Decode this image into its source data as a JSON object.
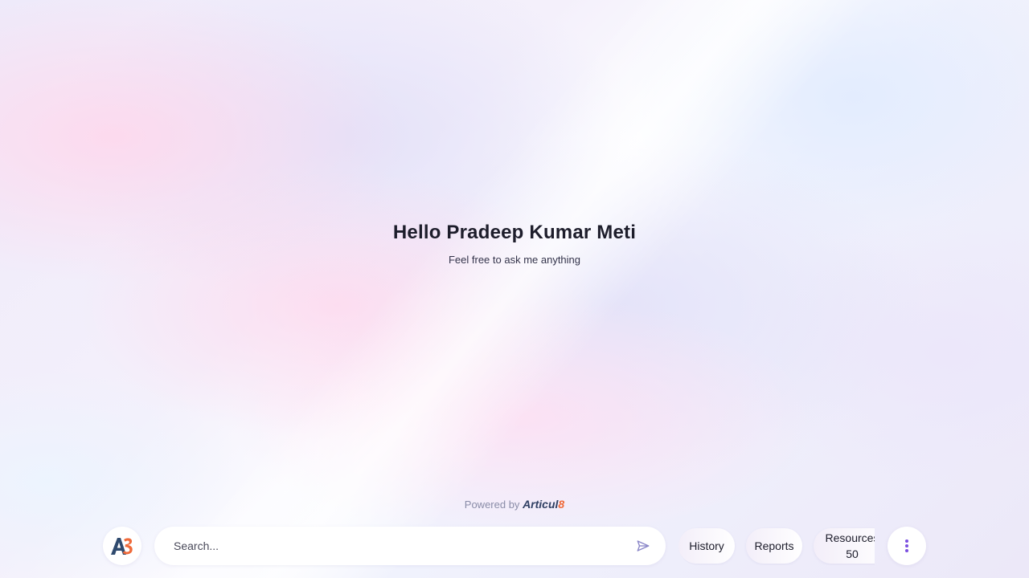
{
  "greeting": {
    "title": "Hello Pradeep Kumar Meti",
    "subtitle": "Feel free to ask me anything"
  },
  "footer": {
    "powered_by": "Powered by",
    "brand_text": "Articul",
    "brand_suffix": "8"
  },
  "search": {
    "placeholder": "Search...",
    "value": ""
  },
  "actions": {
    "history_label": "History",
    "reports_label": "Reports",
    "resources_label": "Resources",
    "resources_count": "50"
  },
  "icons": {
    "logo": "a8-logo-icon",
    "send": "send-icon",
    "menu": "more-vertical-icon"
  },
  "colors": {
    "brand_dark": "#2f3f63",
    "brand_orange": "#ef6a3a",
    "menu_dots": "#7b4fe0",
    "send_icon": "#8a86c8"
  }
}
